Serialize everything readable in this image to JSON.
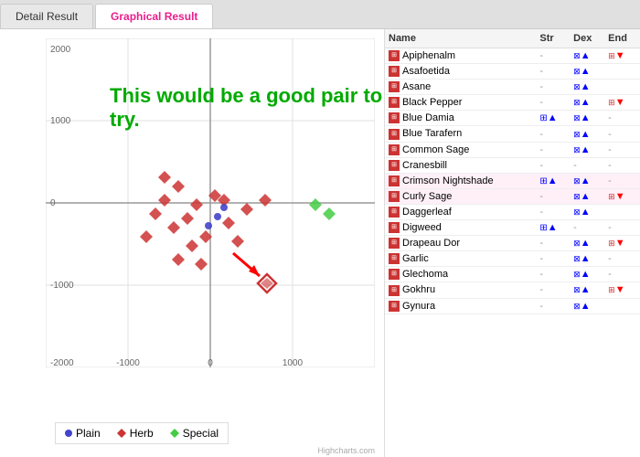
{
  "header": {
    "title": "Graphical Result"
  },
  "tabs": [
    {
      "id": "detail",
      "label": "Detail Result",
      "active": false
    },
    {
      "id": "graphical",
      "label": "Graphical Result",
      "active": true
    }
  ],
  "chart": {
    "tooltip": "This would be a good pair to try.",
    "xAxisRange": [
      -2000,
      2000
    ],
    "yAxisRange": [
      -2000,
      2000
    ],
    "legend": {
      "items": [
        {
          "label": "Plain",
          "color": "#4444cc",
          "shape": "circle"
        },
        {
          "label": "Herb",
          "color": "#cc3333",
          "shape": "diamond"
        },
        {
          "label": "Special",
          "color": "#44cc44",
          "shape": "diamond"
        }
      ]
    },
    "credit": "Highcharts.com"
  },
  "table": {
    "columns": [
      "Name",
      "Str",
      "Dex",
      "End"
    ],
    "rows": [
      {
        "name": "Apiphenalm",
        "str": "-",
        "dex": "▲",
        "end": "▼",
        "highlight": false
      },
      {
        "name": "Asafoetida",
        "str": "-",
        "dex": "▲",
        "end": "",
        "highlight": false
      },
      {
        "name": "Asane",
        "str": "-",
        "dex": "▲",
        "end": "",
        "highlight": false
      },
      {
        "name": "Black Pepper",
        "str": "-",
        "dex": "▲",
        "end": "▼",
        "highlight": false
      },
      {
        "name": "Blue Damia",
        "str": "▲",
        "dex": "▲",
        "end": "-",
        "highlight": false
      },
      {
        "name": "Blue Tarafern",
        "str": "-",
        "dex": "▲",
        "end": "-",
        "highlight": false
      },
      {
        "name": "Common Sage",
        "str": "-",
        "dex": "▲",
        "end": "-",
        "highlight": false
      },
      {
        "name": "Cranesbill",
        "str": "-",
        "dex": "-",
        "end": "-",
        "highlight": false
      },
      {
        "name": "Crimson Nightshade",
        "str": "▲",
        "dex": "▲",
        "end": "-",
        "highlight": true
      },
      {
        "name": "Curly Sage",
        "str": "-",
        "dex": "▲",
        "end": "▼",
        "highlight": true
      },
      {
        "name": "Daggerleaf",
        "str": "-",
        "dex": "▲",
        "end": "",
        "highlight": false
      },
      {
        "name": "Digweed",
        "str": "▲",
        "dex": "-",
        "end": "-",
        "highlight": false
      },
      {
        "name": "Drapeau Dor",
        "str": "-",
        "dex": "▲",
        "end": "▼",
        "highlight": false
      },
      {
        "name": "Garlic",
        "str": "-",
        "dex": "▲",
        "end": "-",
        "highlight": false
      },
      {
        "name": "Glechoma",
        "str": "-",
        "dex": "▲",
        "end": "-",
        "highlight": false
      },
      {
        "name": "Gokhru",
        "str": "-",
        "dex": "▲",
        "end": "▼",
        "highlight": false
      },
      {
        "name": "Gynura",
        "str": "-",
        "dex": "▲",
        "end": "",
        "highlight": false
      }
    ]
  },
  "footer": {
    "special_label": "Plain Herb Special"
  }
}
